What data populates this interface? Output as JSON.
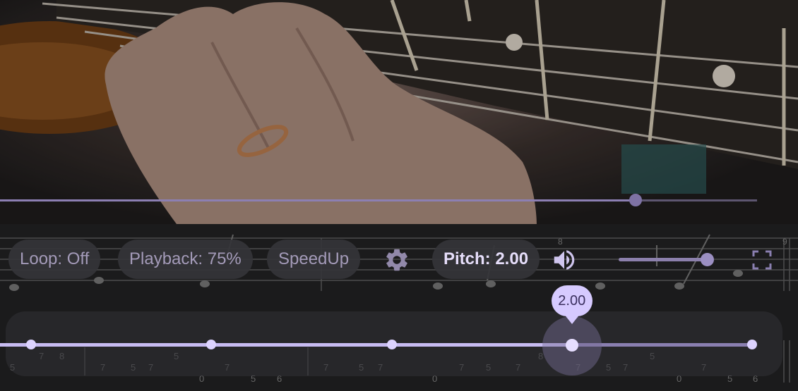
{
  "player": {
    "progress_fraction": 0.84,
    "colors": {
      "accent": "#c8bcf2",
      "track": "#8a7fb0",
      "button_bg": "#343438",
      "button_text": "#a49bb9"
    }
  },
  "controls": {
    "loop_label": "Loop: Off",
    "playback_label": "Playback: 75%",
    "speedup_label": "SpeedUp",
    "settings_icon": "gear-icon",
    "pitch_label": "Pitch: 2.00",
    "volume_icon": "speaker-icon",
    "volume_fraction": 0.93,
    "fullscreen_icon": "fullscreen-icon"
  },
  "pitch_slider": {
    "value_label": "2.00",
    "value_fraction": 0.75,
    "tick_fractions": [
      0.0,
      0.25,
      0.5,
      0.75,
      1.0
    ]
  },
  "tablature": {
    "numbers": [
      "5",
      "7",
      "8",
      "7",
      "5",
      "7",
      "5",
      "0",
      "7",
      "5",
      "6",
      "7",
      "5",
      "7",
      "0",
      "7",
      "5",
      "7",
      "8",
      "7",
      "5",
      "7",
      "5",
      "0",
      "7",
      "5",
      "6"
    ],
    "measure_numbers": [
      "9",
      "8"
    ]
  }
}
